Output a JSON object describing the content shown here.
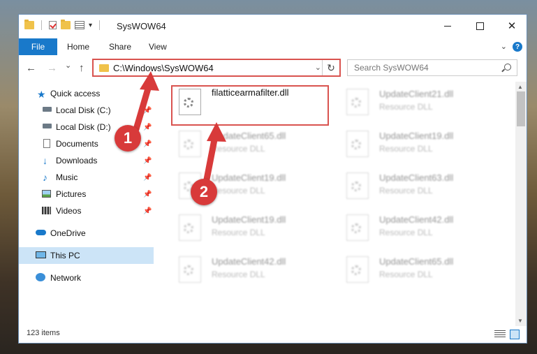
{
  "window": {
    "title": "SysWOW64",
    "controls": {
      "minimize": "",
      "maximize": "",
      "close": "✕"
    }
  },
  "ribbon": {
    "file": "File",
    "home": "Home",
    "share": "Share",
    "view": "View",
    "help": "?"
  },
  "nav": {
    "back": "←",
    "forward": "→",
    "recent": "⌄",
    "up": "↑",
    "address": "C:\\Windows\\SysWOW64",
    "address_dropdown": "⌄",
    "refresh": "↻",
    "search_placeholder": "Search SysWOW64"
  },
  "sidebar": {
    "items": [
      {
        "label": "Quick access",
        "icon": "star-icon"
      },
      {
        "label": "Local Disk (C:)",
        "icon": "drive-icon",
        "pinned": true
      },
      {
        "label": "Local Disk (D:)",
        "icon": "drive-icon",
        "pinned": true
      },
      {
        "label": "Documents",
        "icon": "documents-icon",
        "pinned": true
      },
      {
        "label": "Downloads",
        "icon": "downloads-icon",
        "pinned": true
      },
      {
        "label": "Music",
        "icon": "music-icon",
        "pinned": true
      },
      {
        "label": "Pictures",
        "icon": "pictures-icon",
        "pinned": true
      },
      {
        "label": "Videos",
        "icon": "videos-icon",
        "pinned": true
      },
      {
        "label": "OneDrive",
        "icon": "cloud-icon"
      },
      {
        "label": "This PC",
        "icon": "computer-icon",
        "selected": true
      },
      {
        "label": "Network",
        "icon": "network-icon"
      }
    ]
  },
  "files": [
    {
      "name": "filatticearmafilter.dll",
      "type": "",
      "highlighted": true
    },
    {
      "name": "UpdateClient21.dll",
      "type": "Resource DLL"
    },
    {
      "name": "UpdateClient65.dll",
      "type": "Resource DLL"
    },
    {
      "name": "UpdateClient19.dll",
      "type": "Resource DLL"
    },
    {
      "name": "UpdateClient19.dll",
      "type": "Resource DLL"
    },
    {
      "name": "UpdateClient63.dll",
      "type": "Resource DLL"
    },
    {
      "name": "UpdateClient19.dll",
      "type": "Resource DLL"
    },
    {
      "name": "UpdateClient42.dll",
      "type": "Resource DLL"
    },
    {
      "name": "UpdateClient42.dll",
      "type": "Resource DLL"
    },
    {
      "name": "UpdateClient65.dll",
      "type": "Resource DLL"
    }
  ],
  "status": {
    "items": "123 items"
  },
  "callouts": {
    "one": "1",
    "two": "2"
  },
  "colors": {
    "accent": "#1979ca",
    "callout": "#d83a3a",
    "selected": "#cce4f7"
  }
}
